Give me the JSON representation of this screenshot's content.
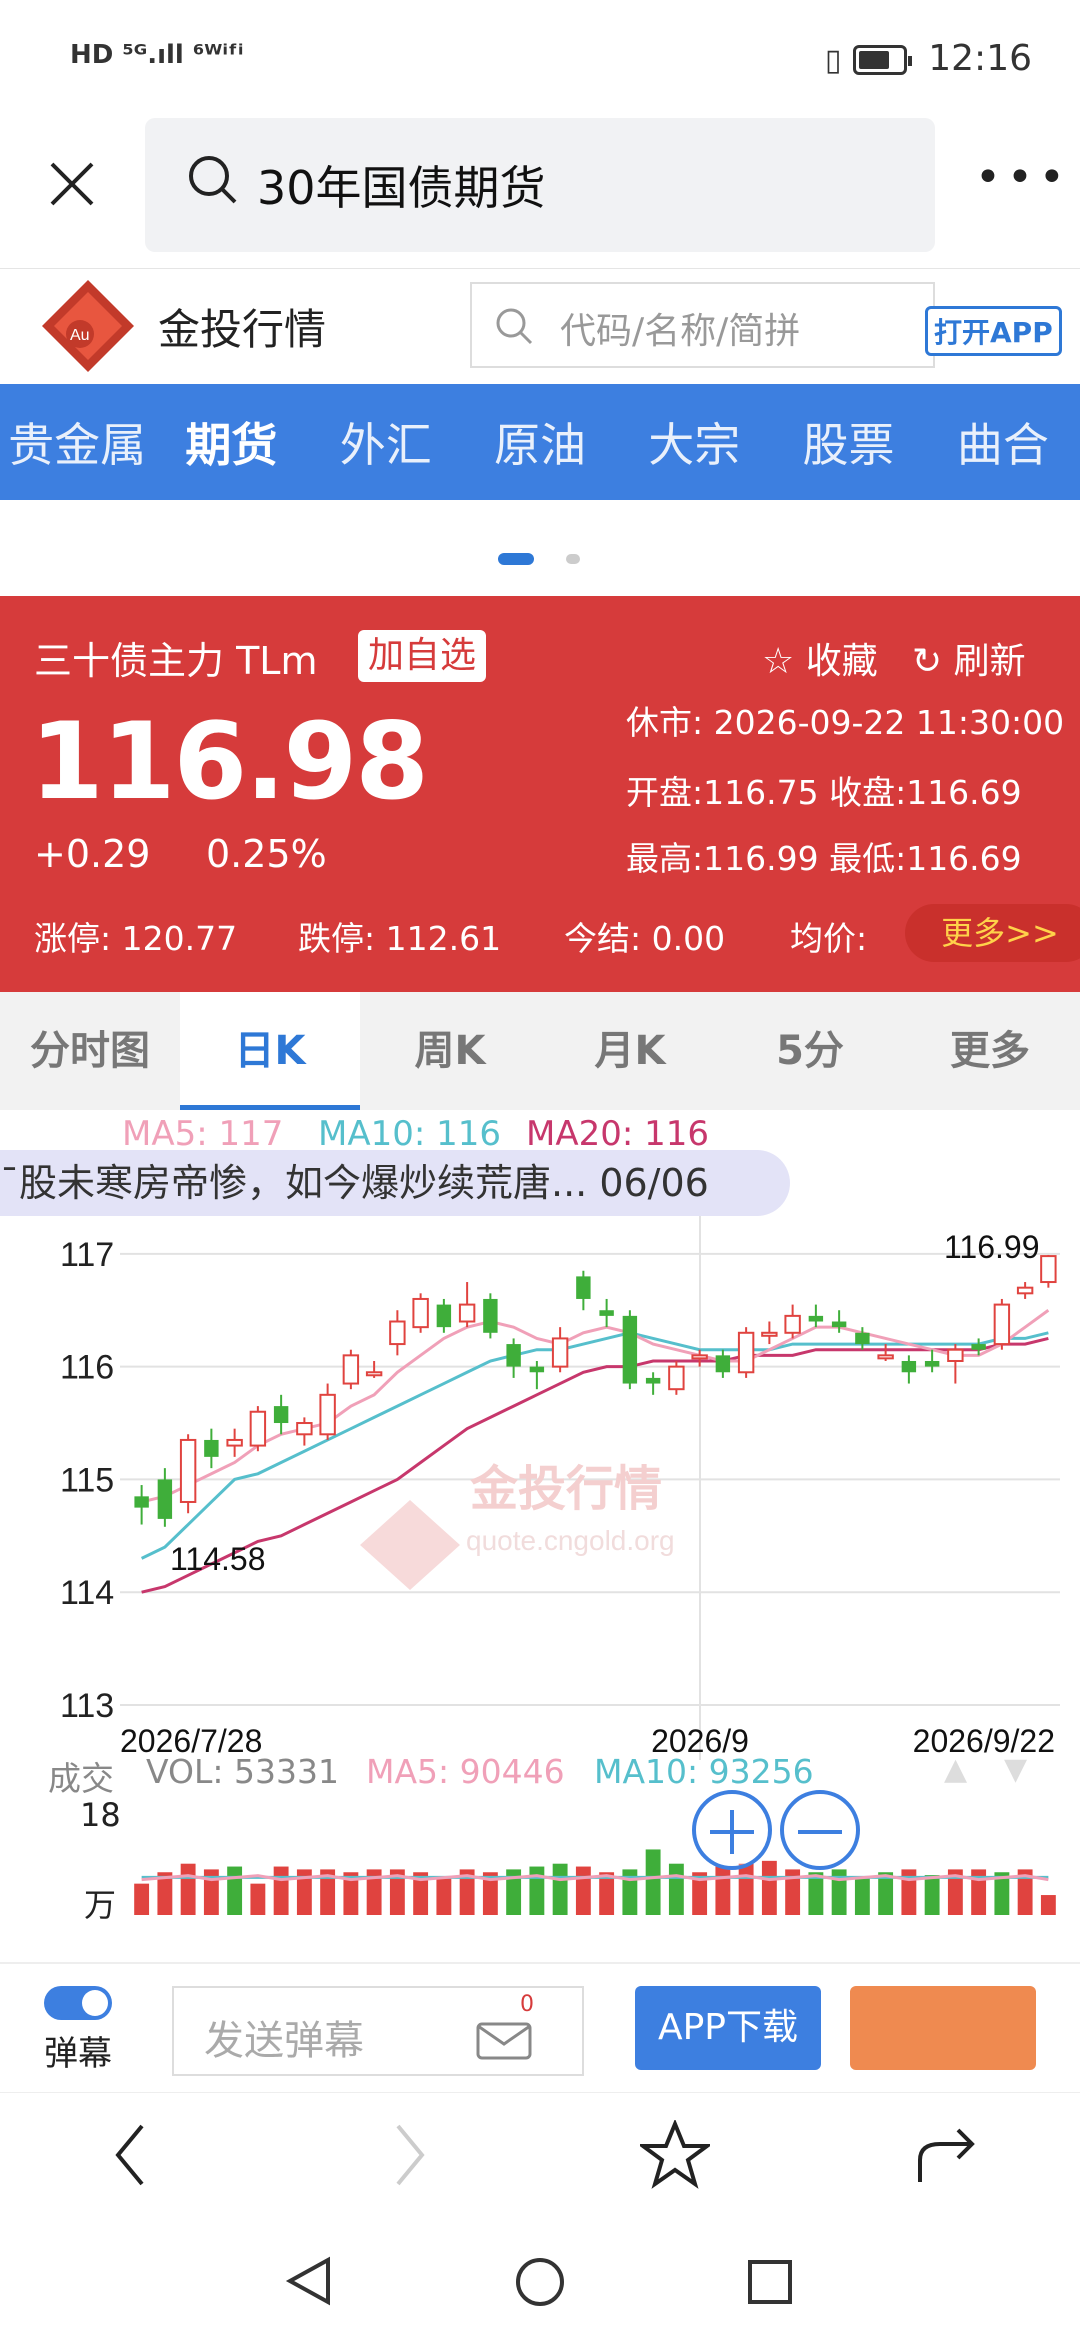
{
  "status_bar": {
    "left": "HD ⁵ᴳ.ıll ⁶ᵂⁱᶠⁱ",
    "time": "12:16"
  },
  "browser": {
    "query": "30年国债期货"
  },
  "site": {
    "brand": "金投行情",
    "logo_text": "Au",
    "search_placeholder": "代码/名称/简拼",
    "open_app": "打开APP"
  },
  "nav": [
    "贵金属",
    "期货",
    "外汇",
    "原油",
    "大宗",
    "股票",
    "曲合"
  ],
  "nav_active": 1,
  "quote": {
    "name": "三十债主力 TLm",
    "add_watch": "加自选",
    "favorite": "收藏",
    "refresh": "刷新",
    "price": "116.98",
    "change": "+0.29",
    "change_pct": "0.25%",
    "status": "休市: 2026-09-22 11:30:00",
    "open_close": "开盘:116.75 收盘:116.69",
    "high_low": "最高:116.99 最低:116.69",
    "limit_up": "涨停: 120.77",
    "limit_down": "跌停: 112.61",
    "settle": "今结: 0.00",
    "avg": "均价:",
    "more": "更多>>"
  },
  "tabs": [
    "分时图",
    "日K",
    "周K",
    "月K",
    "5分",
    "更多"
  ],
  "tab_active": 1,
  "danmaku": "ˉ股未寒房帝惨，如今爆炒续荒唐... 06/06",
  "chart_data": {
    "type": "candlestick",
    "ma_labels": {
      "ma5": "MA5: 117",
      "ma10": "MA10: 116",
      "ma20": "MA20: 116"
    },
    "y_ticks": [
      "117",
      "116",
      "115",
      "114",
      "113"
    ],
    "ylim": [
      113,
      117.3
    ],
    "x_labels": [
      "2026/7/28",
      "2026/9",
      "2026/9/22"
    ],
    "annot_high": "116.99",
    "annot_low": "114.58",
    "watermark": "金投行情",
    "watermark_url": "quote.cngold.org",
    "candles": [
      {
        "o": 114.85,
        "c": 114.75,
        "h": 114.95,
        "l": 114.6,
        "up": false
      },
      {
        "o": 114.65,
        "c": 115.0,
        "h": 115.1,
        "l": 114.58,
        "up": false
      },
      {
        "o": 114.8,
        "c": 115.35,
        "h": 115.4,
        "l": 114.7,
        "up": true
      },
      {
        "o": 115.35,
        "c": 115.2,
        "h": 115.45,
        "l": 115.1,
        "up": false
      },
      {
        "o": 115.3,
        "c": 115.35,
        "h": 115.45,
        "l": 115.2,
        "up": true
      },
      {
        "o": 115.3,
        "c": 115.6,
        "h": 115.65,
        "l": 115.25,
        "up": true
      },
      {
        "o": 115.65,
        "c": 115.5,
        "h": 115.75,
        "l": 115.4,
        "up": false
      },
      {
        "o": 115.4,
        "c": 115.5,
        "h": 115.55,
        "l": 115.3,
        "up": true
      },
      {
        "o": 115.4,
        "c": 115.75,
        "h": 115.85,
        "l": 115.35,
        "up": true
      },
      {
        "o": 115.85,
        "c": 116.1,
        "h": 116.15,
        "l": 115.8,
        "up": true
      },
      {
        "o": 115.95,
        "c": 115.95,
        "h": 116.05,
        "l": 115.9,
        "up": true
      },
      {
        "o": 116.2,
        "c": 116.4,
        "h": 116.5,
        "l": 116.1,
        "up": true
      },
      {
        "o": 116.35,
        "c": 116.6,
        "h": 116.65,
        "l": 116.3,
        "up": true
      },
      {
        "o": 116.55,
        "c": 116.35,
        "h": 116.6,
        "l": 116.3,
        "up": false
      },
      {
        "o": 116.4,
        "c": 116.55,
        "h": 116.75,
        "l": 116.35,
        "up": true
      },
      {
        "o": 116.6,
        "c": 116.3,
        "h": 116.65,
        "l": 116.25,
        "up": false
      },
      {
        "o": 116.2,
        "c": 116.0,
        "h": 116.25,
        "l": 115.9,
        "up": false
      },
      {
        "o": 116.0,
        "c": 115.95,
        "h": 116.05,
        "l": 115.8,
        "up": false
      },
      {
        "o": 116.0,
        "c": 116.25,
        "h": 116.35,
        "l": 115.95,
        "up": true
      },
      {
        "o": 116.8,
        "c": 116.6,
        "h": 116.85,
        "l": 116.5,
        "up": false
      },
      {
        "o": 116.5,
        "c": 116.45,
        "h": 116.6,
        "l": 116.35,
        "up": false
      },
      {
        "o": 116.45,
        "c": 115.85,
        "h": 116.5,
        "l": 115.8,
        "up": false
      },
      {
        "o": 115.9,
        "c": 115.85,
        "h": 115.95,
        "l": 115.75,
        "up": false
      },
      {
        "o": 115.8,
        "c": 116.0,
        "h": 116.05,
        "l": 115.75,
        "up": true
      },
      {
        "o": 116.1,
        "c": 116.1,
        "h": 116.15,
        "l": 116.0,
        "up": true
      },
      {
        "o": 116.1,
        "c": 115.95,
        "h": 116.15,
        "l": 115.9,
        "up": false
      },
      {
        "o": 115.95,
        "c": 116.3,
        "h": 116.35,
        "l": 115.9,
        "up": true
      },
      {
        "o": 116.3,
        "c": 116.3,
        "h": 116.4,
        "l": 116.2,
        "up": true
      },
      {
        "o": 116.3,
        "c": 116.45,
        "h": 116.55,
        "l": 116.25,
        "up": true
      },
      {
        "o": 116.45,
        "c": 116.4,
        "h": 116.55,
        "l": 116.35,
        "up": false
      },
      {
        "o": 116.4,
        "c": 116.35,
        "h": 116.5,
        "l": 116.3,
        "up": false
      },
      {
        "o": 116.3,
        "c": 116.2,
        "h": 116.35,
        "l": 116.15,
        "up": false
      },
      {
        "o": 116.1,
        "c": 116.1,
        "h": 116.2,
        "l": 116.05,
        "up": true
      },
      {
        "o": 116.05,
        "c": 115.95,
        "h": 116.1,
        "l": 115.85,
        "up": false
      },
      {
        "o": 116.05,
        "c": 116.0,
        "h": 116.15,
        "l": 115.95,
        "up": false
      },
      {
        "o": 116.05,
        "c": 116.15,
        "h": 116.2,
        "l": 115.85,
        "up": true
      },
      {
        "o": 116.2,
        "c": 116.15,
        "h": 116.25,
        "l": 116.1,
        "up": false
      },
      {
        "o": 116.2,
        "c": 116.55,
        "h": 116.6,
        "l": 116.15,
        "up": true
      },
      {
        "o": 116.65,
        "c": 116.7,
        "h": 116.75,
        "l": 116.6,
        "up": true
      },
      {
        "o": 116.75,
        "c": 116.98,
        "h": 116.99,
        "l": 116.7,
        "up": true
      }
    ],
    "ma5": [
      114.8,
      114.85,
      114.95,
      115.05,
      115.15,
      115.3,
      115.4,
      115.45,
      115.5,
      115.65,
      115.75,
      115.95,
      116.1,
      116.25,
      116.35,
      116.4,
      116.35,
      116.25,
      116.2,
      116.3,
      116.35,
      116.3,
      116.2,
      116.15,
      116.1,
      116.05,
      116.05,
      116.15,
      116.25,
      116.35,
      116.35,
      116.3,
      116.25,
      116.2,
      116.15,
      116.1,
      116.1,
      116.2,
      116.35,
      116.5
    ],
    "ma10": [
      114.3,
      114.4,
      114.6,
      114.8,
      115.0,
      115.05,
      115.15,
      115.25,
      115.35,
      115.45,
      115.55,
      115.65,
      115.75,
      115.85,
      115.95,
      116.05,
      116.1,
      116.15,
      116.15,
      116.2,
      116.25,
      116.3,
      116.25,
      116.2,
      116.15,
      116.15,
      116.15,
      116.15,
      116.2,
      116.2,
      116.2,
      116.2,
      116.2,
      116.2,
      116.2,
      116.2,
      116.2,
      116.25,
      116.25,
      116.3
    ],
    "ma20": [
      114.0,
      114.05,
      114.15,
      114.25,
      114.35,
      114.45,
      114.5,
      114.6,
      114.7,
      114.8,
      114.9,
      115.0,
      115.15,
      115.3,
      115.45,
      115.55,
      115.65,
      115.75,
      115.85,
      115.95,
      116.0,
      116.0,
      116.05,
      116.05,
      116.05,
      116.05,
      116.1,
      116.1,
      116.1,
      116.15,
      116.15,
      116.15,
      116.15,
      116.15,
      116.15,
      116.15,
      116.15,
      116.2,
      116.2,
      116.25
    ]
  },
  "volume": {
    "title": "成交",
    "vol": "VOL: 53331",
    "ma5": "MA5: 90446",
    "ma10": "MA10: 93256",
    "y_top": "18",
    "y_unit": "万",
    "bars": [
      0.55,
      0.75,
      0.9,
      0.8,
      0.85,
      0.55,
      0.85,
      0.8,
      0.8,
      0.75,
      0.8,
      0.8,
      0.75,
      0.65,
      0.8,
      0.75,
      0.8,
      0.85,
      0.9,
      0.85,
      0.75,
      0.8,
      1.15,
      0.9,
      0.75,
      0.85,
      0.9,
      0.95,
      0.8,
      0.75,
      0.8,
      0.65,
      0.75,
      0.8,
      0.7,
      0.8,
      0.8,
      0.75,
      0.8,
      0.35
    ],
    "up": [
      true,
      true,
      true,
      true,
      false,
      true,
      true,
      true,
      true,
      true,
      true,
      true,
      true,
      true,
      true,
      true,
      false,
      false,
      false,
      true,
      true,
      false,
      false,
      false,
      true,
      true,
      true,
      true,
      true,
      false,
      false,
      false,
      false,
      true,
      false,
      true,
      true,
      false,
      true,
      true
    ]
  },
  "bottom": {
    "toggle_label": "弹幕",
    "send_placeholder": "发送弹幕",
    "badge": "0",
    "app_download": "APP下载"
  }
}
